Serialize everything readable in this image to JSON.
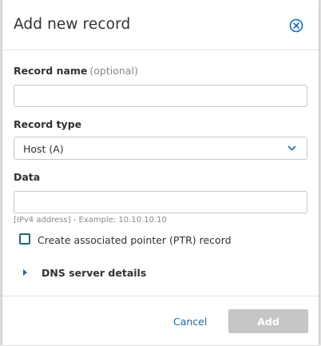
{
  "dialog": {
    "title": "Add new record",
    "close_icon": "close-circle-icon"
  },
  "record_name": {
    "label": "Record name",
    "optional_label": "(optional)",
    "value": "",
    "placeholder": ""
  },
  "record_type": {
    "label": "Record type",
    "selected": "Host (A)",
    "icon": "chevron-down-icon"
  },
  "data_field": {
    "label": "Data",
    "value": "",
    "placeholder": "",
    "hint": "[IPv4 address] - Example: 10.10.10.10"
  },
  "ptr_checkbox": {
    "label": "Create associated pointer (PTR) record",
    "checked": false
  },
  "dns_details": {
    "label": "DNS server details",
    "icon": "caret-right-icon"
  },
  "footer": {
    "cancel_label": "Cancel",
    "add_label": "Add"
  },
  "colors": {
    "accent": "#0f6cbd",
    "checkbox_border": "#1c6a73",
    "disabled_button": "#c8c6c4"
  }
}
